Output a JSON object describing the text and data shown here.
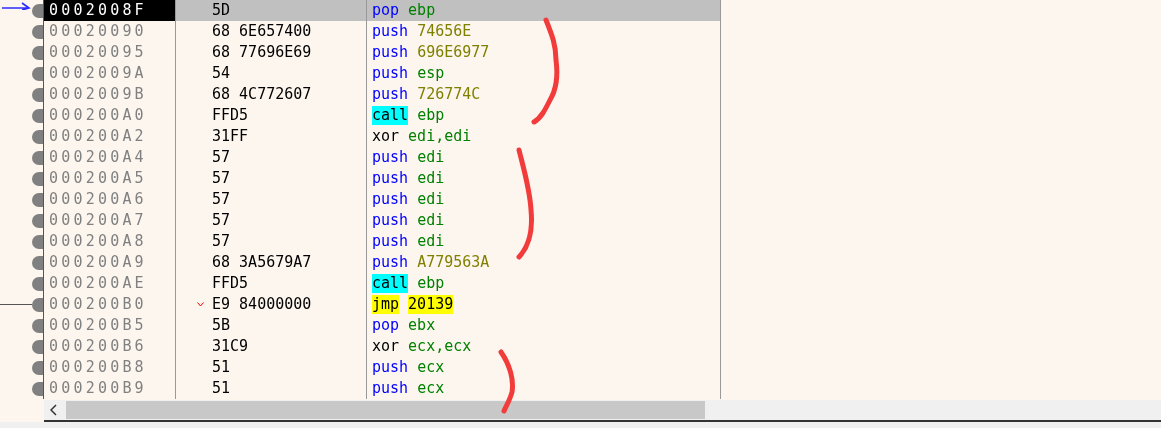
{
  "rows": [
    {
      "address": "0002008F",
      "bytes": "5D",
      "jump": false,
      "selected": true,
      "tokens": [
        {
          "text": "pop",
          "kind": "stackop"
        },
        {
          "text": "ebp",
          "kind": "register"
        }
      ]
    },
    {
      "address": "00020090",
      "bytes": "68 6E657400",
      "jump": false,
      "selected": false,
      "tokens": [
        {
          "text": "push",
          "kind": "stackop"
        },
        {
          "text": "74656E",
          "kind": "number"
        }
      ]
    },
    {
      "address": "00020095",
      "bytes": "68 77696E69",
      "jump": false,
      "selected": false,
      "tokens": [
        {
          "text": "push",
          "kind": "stackop"
        },
        {
          "text": "696E6977",
          "kind": "number"
        }
      ]
    },
    {
      "address": "0002009A",
      "bytes": "54",
      "jump": false,
      "selected": false,
      "tokens": [
        {
          "text": "push",
          "kind": "stackop"
        },
        {
          "text": "esp",
          "kind": "register"
        }
      ]
    },
    {
      "address": "0002009B",
      "bytes": "68 4C772607",
      "jump": false,
      "selected": false,
      "tokens": [
        {
          "text": "push",
          "kind": "stackop"
        },
        {
          "text": "726774C",
          "kind": "number"
        }
      ]
    },
    {
      "address": "000200A0",
      "bytes": "FFD5",
      "jump": false,
      "selected": false,
      "tokens": [
        {
          "text": "call",
          "kind": "callop"
        },
        {
          "text": "ebp",
          "kind": "register"
        }
      ]
    },
    {
      "address": "000200A2",
      "bytes": "31FF",
      "jump": false,
      "selected": false,
      "tokens": [
        {
          "text": "xor",
          "kind": "plainop"
        },
        {
          "text": "edi,edi",
          "kind": "register"
        }
      ]
    },
    {
      "address": "000200A4",
      "bytes": "57",
      "jump": false,
      "selected": false,
      "tokens": [
        {
          "text": "push",
          "kind": "stackop"
        },
        {
          "text": "edi",
          "kind": "register"
        }
      ]
    },
    {
      "address": "000200A5",
      "bytes": "57",
      "jump": false,
      "selected": false,
      "tokens": [
        {
          "text": "push",
          "kind": "stackop"
        },
        {
          "text": "edi",
          "kind": "register"
        }
      ]
    },
    {
      "address": "000200A6",
      "bytes": "57",
      "jump": false,
      "selected": false,
      "tokens": [
        {
          "text": "push",
          "kind": "stackop"
        },
        {
          "text": "edi",
          "kind": "register"
        }
      ]
    },
    {
      "address": "000200A7",
      "bytes": "57",
      "jump": false,
      "selected": false,
      "tokens": [
        {
          "text": "push",
          "kind": "stackop"
        },
        {
          "text": "edi",
          "kind": "register"
        }
      ]
    },
    {
      "address": "000200A8",
      "bytes": "57",
      "jump": false,
      "selected": false,
      "tokens": [
        {
          "text": "push",
          "kind": "stackop"
        },
        {
          "text": "edi",
          "kind": "register"
        }
      ]
    },
    {
      "address": "000200A9",
      "bytes": "68 3A5679A7",
      "jump": false,
      "selected": false,
      "tokens": [
        {
          "text": "push",
          "kind": "stackop"
        },
        {
          "text": "A779563A",
          "kind": "number"
        }
      ]
    },
    {
      "address": "000200AE",
      "bytes": "FFD5",
      "jump": false,
      "selected": false,
      "tokens": [
        {
          "text": "call",
          "kind": "callop"
        },
        {
          "text": "ebp",
          "kind": "register"
        }
      ]
    },
    {
      "address": "000200B0",
      "bytes": "E9 84000000",
      "jump": true,
      "selected": false,
      "tokens": [
        {
          "text": "jmp",
          "kind": "jumpop"
        },
        {
          "text": "20139",
          "kind": "target"
        }
      ]
    },
    {
      "address": "000200B5",
      "bytes": "5B",
      "jump": false,
      "selected": false,
      "tokens": [
        {
          "text": "pop",
          "kind": "stackop"
        },
        {
          "text": "ebx",
          "kind": "register"
        }
      ]
    },
    {
      "address": "000200B6",
      "bytes": "31C9",
      "jump": false,
      "selected": false,
      "tokens": [
        {
          "text": "xor",
          "kind": "plainop"
        },
        {
          "text": "ecx,ecx",
          "kind": "register"
        }
      ]
    },
    {
      "address": "000200B8",
      "bytes": "51",
      "jump": false,
      "selected": false,
      "tokens": [
        {
          "text": "push",
          "kind": "stackop"
        },
        {
          "text": "ecx",
          "kind": "register"
        }
      ]
    },
    {
      "address": "000200B9",
      "bytes": "51",
      "jump": false,
      "selected": false,
      "tokens": [
        {
          "text": "push",
          "kind": "stackop"
        },
        {
          "text": "ecx",
          "kind": "register"
        }
      ]
    }
  ]
}
